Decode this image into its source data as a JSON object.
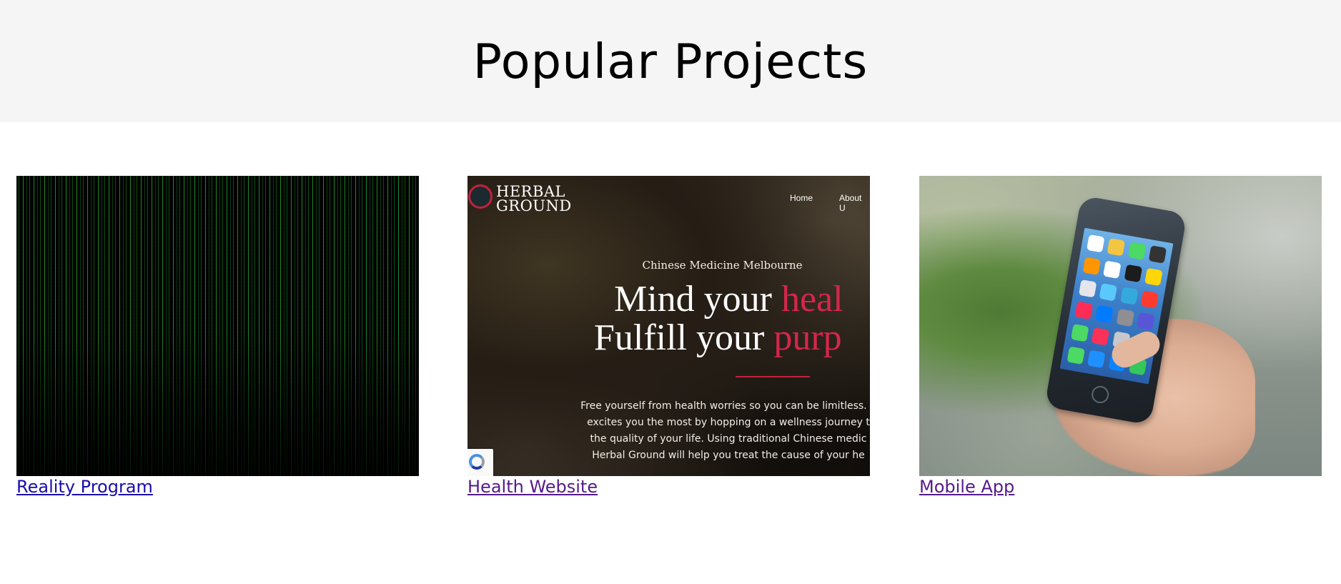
{
  "header": {
    "title": "Popular Projects"
  },
  "projects": [
    {
      "title": "Reality Program",
      "image_icon": "matrix-code-image"
    },
    {
      "title": "Health Website",
      "image_icon": "herbal-ground-website-image",
      "preview": {
        "logo_line1": "HERBAL",
        "logo_line2": "GROUND",
        "nav_home": "Home",
        "nav_about": "About U",
        "kicker": "Chinese Medicine Melbourne",
        "headline1_a": "Mind your ",
        "headline1_b": "heal",
        "headline2_a": "Fulfill your ",
        "headline2_b": "purp",
        "body_line1": "Free yourself from health worries so you can be limitless. E",
        "body_line2": "excites you the most by hopping on a wellness journey t",
        "body_line3": "the quality of your life. Using traditional Chinese medic",
        "body_line4": "Herbal Ground will help you treat the cause of your he",
        "accent_color": "#d6264b"
      }
    },
    {
      "title": "Mobile App",
      "image_icon": "hand-holding-phone-image"
    }
  ],
  "colors": {
    "header_bg": "#f5f5f5",
    "link": "#1a0dab",
    "visited_link": "#551a8b"
  }
}
